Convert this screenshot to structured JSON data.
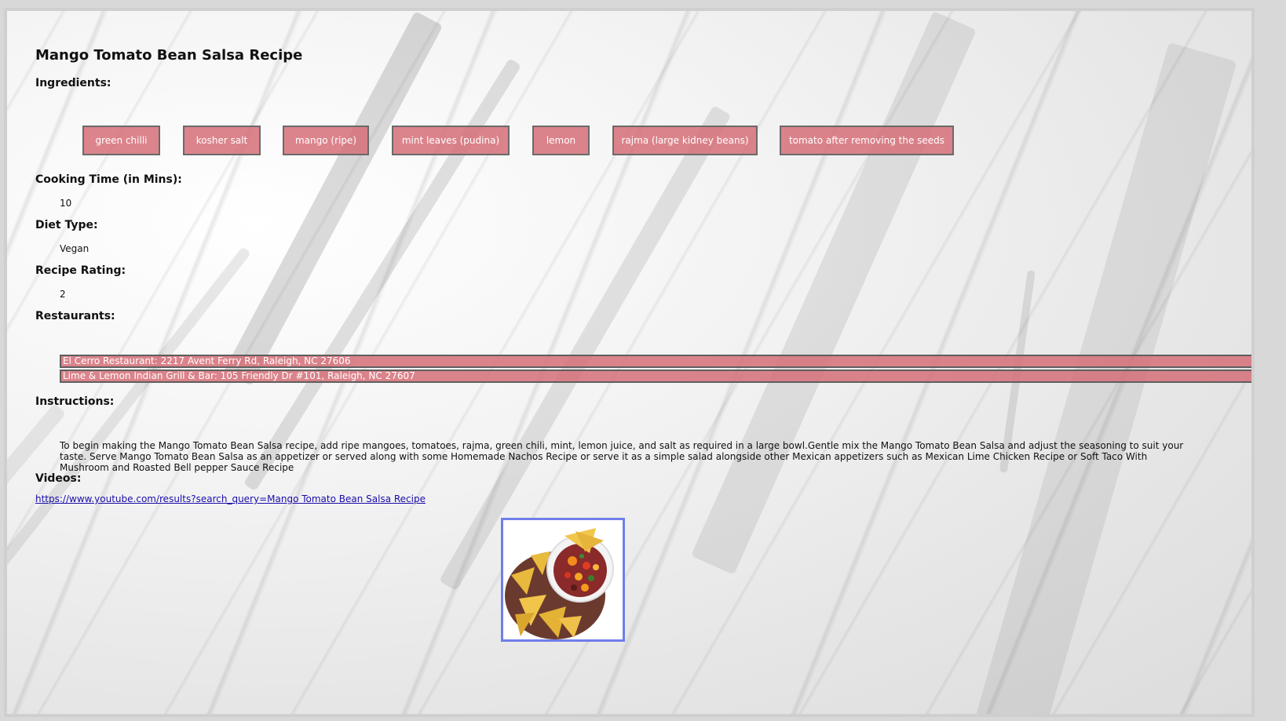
{
  "recipe": {
    "title": "Mango Tomato Bean Salsa Recipe",
    "ingredients_label": "Ingredients:",
    "ingredients": [
      "green chilli",
      "kosher salt",
      "mango (ripe)",
      "mint leaves (pudina)",
      "lemon",
      "rajma (large kidney beans)",
      "tomato after removing the seeds"
    ],
    "cooking_time_label": "Cooking Time (in Mins):",
    "cooking_time": "10",
    "diet_type_label": "Diet Type:",
    "diet_type": "Vegan",
    "rating_label": "Recipe Rating:",
    "rating": "2",
    "restaurants_label": "Restaurants:",
    "restaurants": [
      "El Cerro Restaurant: 2217 Avent Ferry Rd, Raleigh, NC 27606",
      "Lime & Lemon Indian Grill & Bar: 105 Friendly Dr #101, Raleigh, NC 27607"
    ],
    "instructions_label": "Instructions:",
    "instructions": "To begin making the Mango Tomato Bean Salsa recipe, add ripe mangoes, tomatoes, rajma, green chili, mint, lemon juice, and salt as required in a large bowl.Gentle mix the Mango Tomato Bean Salsa and adjust the seasoning to suit your taste. Serve Mango Tomato Bean Salsa as an appetizer or served along with some Homemade Nachos Recipe or serve it as a simple salad alongside other Mexican appetizers such as Mexican Lime Chicken Recipe or Soft Taco With Mushroom and Roasted Bell pepper Sauce Recipe",
    "videos_label": "Videos:",
    "video_link": "https://www.youtube.com/results?search_query=Mango Tomato Bean Salsa Recipe"
  },
  "colors": {
    "chip_bg": "#d66e78",
    "chip_border": "#6a6a6a",
    "link": "#1a0dab",
    "photo_border": "#6f7ee8"
  }
}
